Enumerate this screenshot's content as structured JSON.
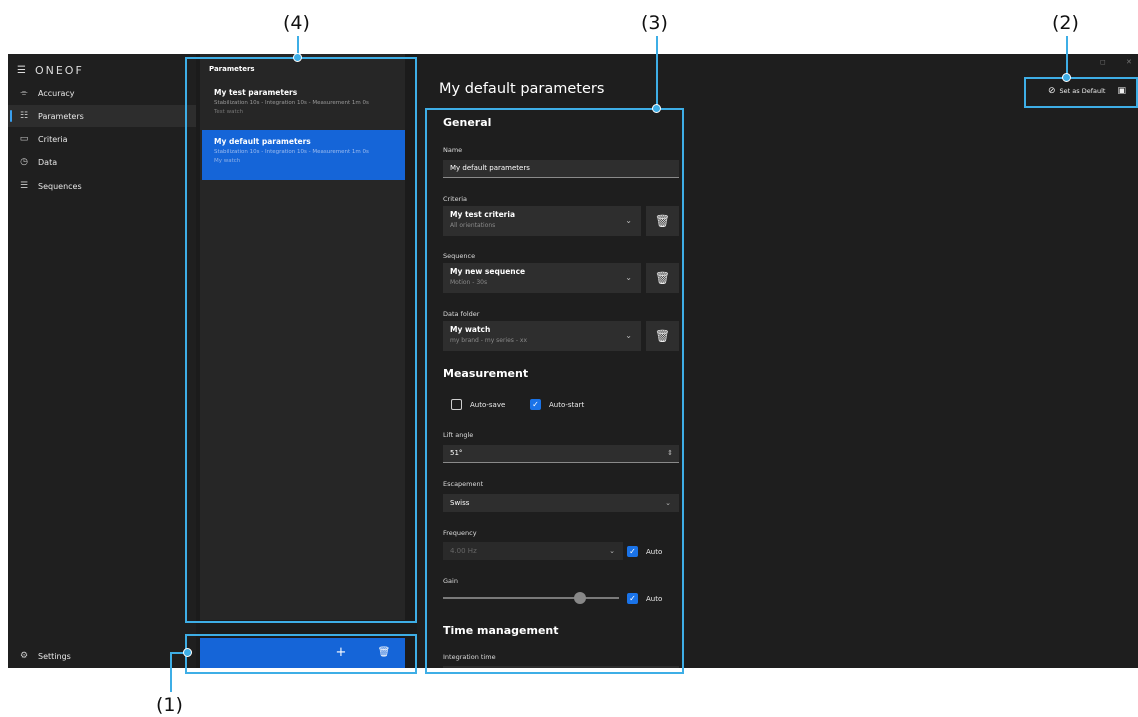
{
  "callouts": {
    "c1": "(1)",
    "c2": "(2)",
    "c3": "(3)",
    "c4": "(4)"
  },
  "app": {
    "logo": "ONEOF"
  },
  "sidebar": {
    "items": [
      {
        "label": "Accuracy",
        "icon": "accuracy-icon"
      },
      {
        "label": "Parameters",
        "icon": "sliders-icon",
        "active": true
      },
      {
        "label": "Criteria",
        "icon": "monitor-icon"
      },
      {
        "label": "Data",
        "icon": "stopwatch-icon"
      },
      {
        "label": "Sequences",
        "icon": "list-icon"
      }
    ],
    "settings_label": "Settings"
  },
  "list": {
    "title": "Parameters",
    "items": [
      {
        "title": "My test parameters",
        "subtitle": "Stabilization 10s - Integration 10s - Measurement 1m 0s",
        "meta": "Test watch",
        "selected": false
      },
      {
        "title": "My default parameters",
        "subtitle": "Stabilization 10s - Integration 10s - Measurement 1m 0s",
        "meta": "My watch",
        "selected": true
      }
    ]
  },
  "detail": {
    "title": "My default parameters",
    "set_default_label": "Set as Default",
    "general": {
      "heading": "General",
      "name_label": "Name",
      "name_value": "My default parameters",
      "criteria_label": "Criteria",
      "criteria_title": "My test criteria",
      "criteria_sub": "All orientations",
      "sequence_label": "Sequence",
      "sequence_title": "My new sequence",
      "sequence_sub": "Motion - 30s",
      "folder_label": "Data folder",
      "folder_title": "My watch",
      "folder_sub": "my brand - my series - xx"
    },
    "measurement": {
      "heading": "Measurement",
      "autosave_label": "Auto-save",
      "autosave_checked": false,
      "autostart_label": "Auto-start",
      "autostart_checked": true,
      "lift_label": "Lift angle",
      "lift_value": "51°",
      "escapement_label": "Escapement",
      "escapement_value": "Swiss",
      "frequency_label": "Frequency",
      "frequency_value": "4.00 Hz",
      "frequency_auto_label": "Auto",
      "gain_label": "Gain",
      "gain_auto_label": "Auto",
      "gain_level": 0.78
    },
    "time": {
      "heading": "Time management",
      "integration_label": "Integration time"
    }
  },
  "colors": {
    "accent": "#1565d8",
    "callout": "#3eaee6",
    "background": "#1e1e1e"
  }
}
